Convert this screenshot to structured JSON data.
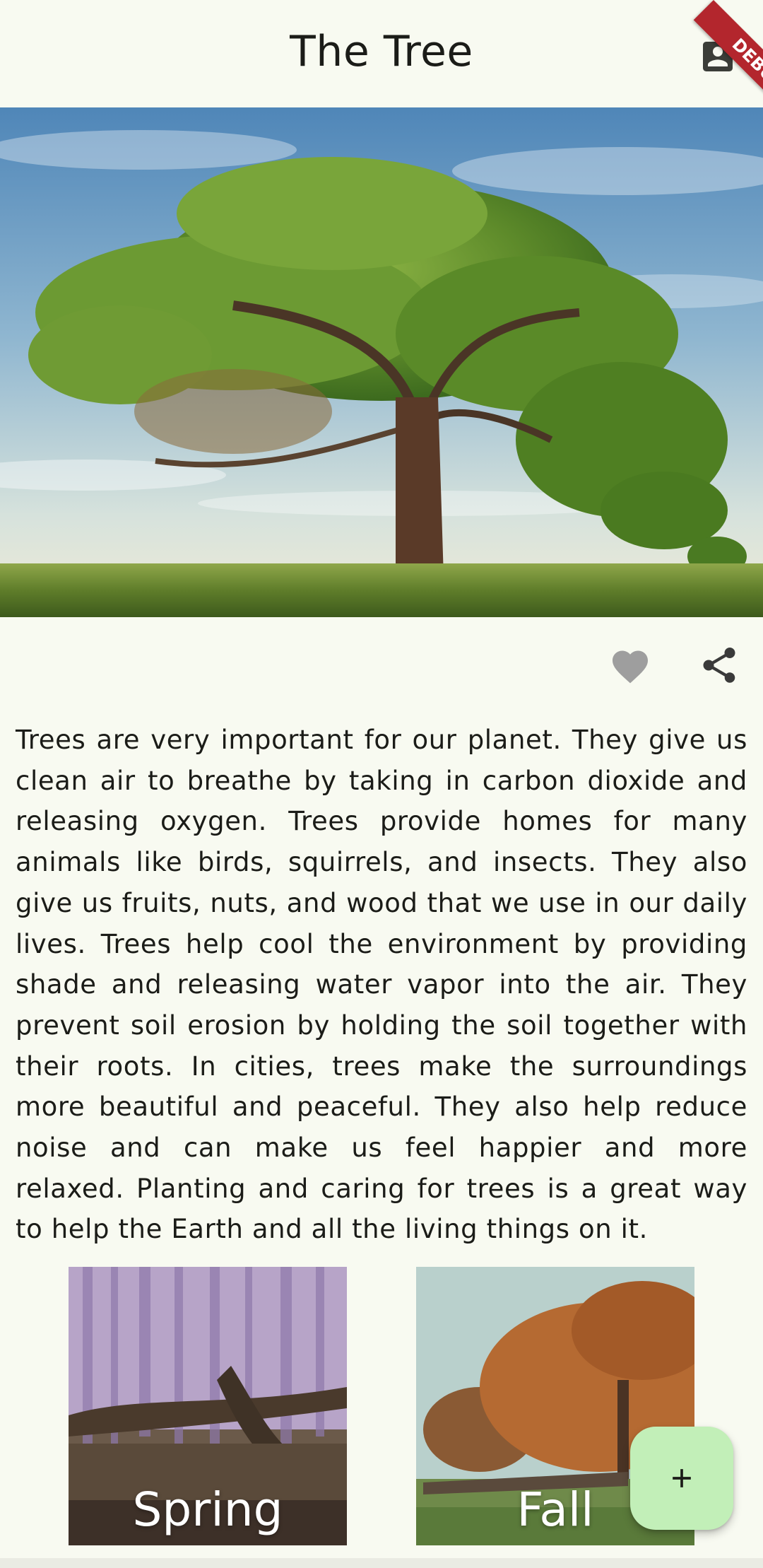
{
  "appbar": {
    "title": "The Tree",
    "account_icon": "account-box-icon",
    "debug_banner": "DEBUG"
  },
  "hero": {
    "icon": "tree-landscape-image"
  },
  "actions": {
    "favorite_icon": "heart-icon",
    "share_icon": "share-icon",
    "colors": {
      "icon": "#9e9e9e",
      "share": "#3a3a3a"
    }
  },
  "article": {
    "text": "Trees are very important for our planet. They give us clean air to breathe by taking in carbon dioxide and releasing oxygen. Trees provide homes for many animals like birds, squirrels, and insects. They also give us fruits, nuts, and wood that we use in our daily lives. Trees help cool the environment by providing shade and releasing water vapor into the air. They prevent soil erosion by holding the soil together with their roots. In cities, trees make the surroundings more beautiful and peaceful. They also help reduce noise and can make us feel happier and more relaxed. Planting and caring for trees is a great way to help the Earth and all the living things on it."
  },
  "seasons": [
    {
      "label": "Spring"
    },
    {
      "label": "Fall"
    }
  ],
  "fab": {
    "icon": "plus-icon",
    "color": "#c2efb8"
  }
}
